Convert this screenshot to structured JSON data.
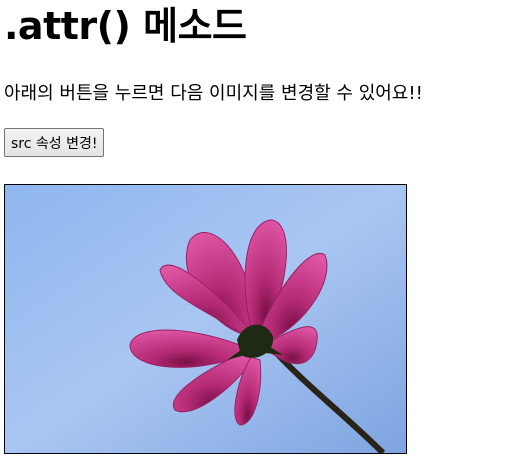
{
  "heading": ".attr() 메소드",
  "description": "아래의 버튼을 누르면 다음 이미지를 변경할 수 있어요!!",
  "button_label": "src 속성 변경!",
  "image": {
    "subject": "pink-cosmos-flower-photo",
    "sky_colors": [
      "#7ea6e8",
      "#b7d0f3"
    ],
    "petal_color": "#c4317f"
  }
}
